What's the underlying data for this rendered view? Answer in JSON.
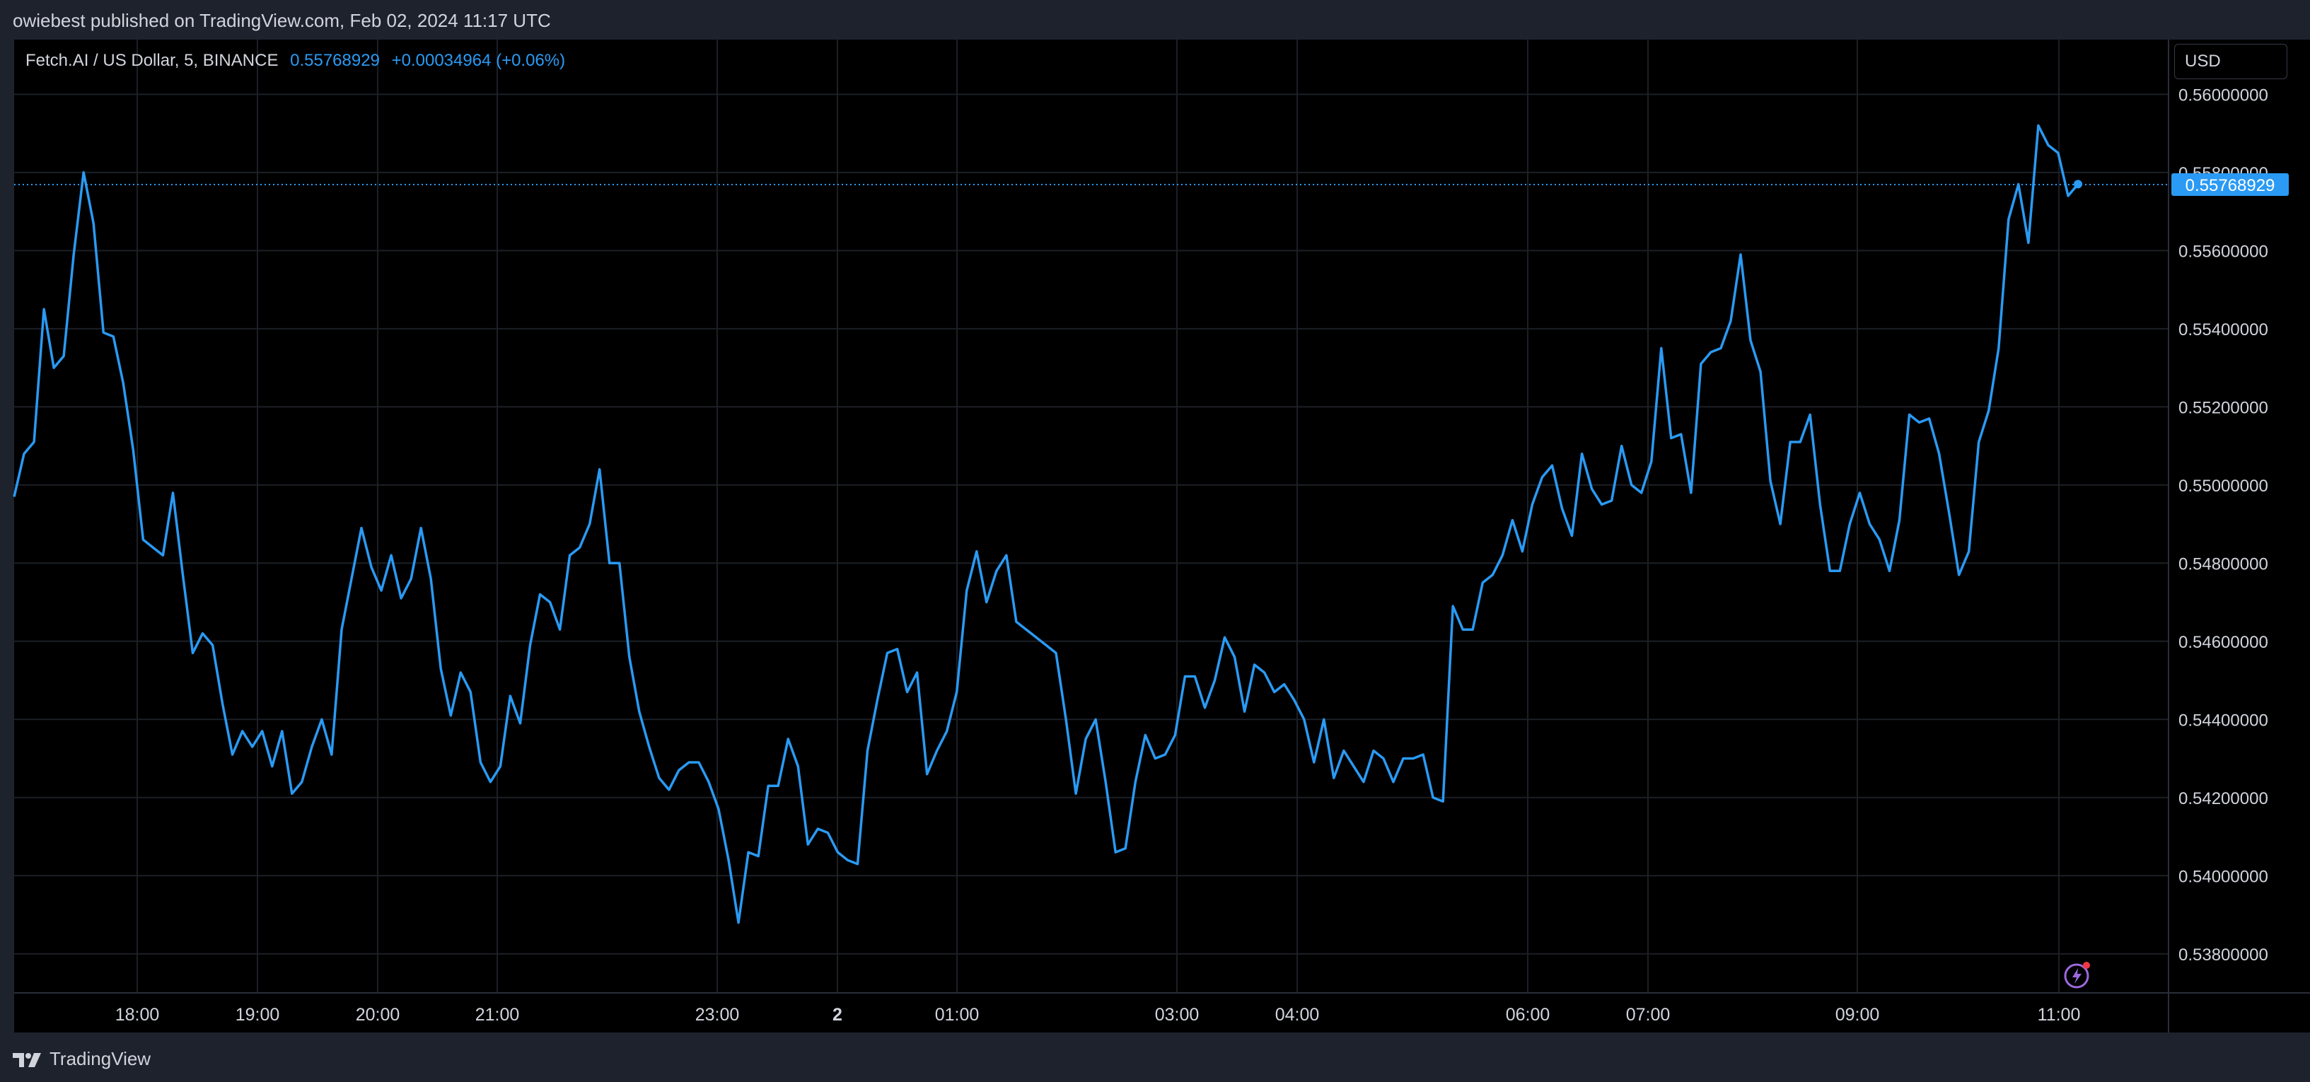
{
  "header": {
    "published_text": "owiebest published on TradingView.com, Feb 02, 2024 11:17 UTC"
  },
  "legend": {
    "symbol": "Fetch.AI / US Dollar, 5, BINANCE",
    "price": "0.55768929",
    "change": "+0.00034964 (+0.06%)"
  },
  "currency_button": "USD",
  "last_price_label": "0.55768929",
  "footer": {
    "brand": "TradingView"
  },
  "colors": {
    "line": "#2a9af4",
    "background": "#000000",
    "grid": "#1c1f26",
    "text": "#d1d4dc"
  },
  "icons": [
    "tradingview-logo-icon",
    "lightning-icon"
  ],
  "chart_data": {
    "type": "line",
    "series": [
      {
        "values": [
          0.5497,
          0.5508,
          0.5511,
          0.5545,
          0.553,
          0.5533,
          0.5559,
          0.558,
          0.5567,
          0.5539,
          0.5538,
          0.5526,
          0.5509,
          0.5486,
          0.5484,
          0.5482,
          0.5498,
          0.5477,
          0.5457,
          0.5462,
          0.5459,
          0.5444,
          0.5431,
          0.5437,
          0.5433,
          0.5437,
          0.5428,
          0.5437,
          0.5421,
          0.5424,
          0.5433,
          0.544,
          0.5431,
          0.5463,
          0.5476,
          0.5489,
          0.5479,
          0.5473,
          0.5482,
          0.5471,
          0.5476,
          0.5489,
          0.5476,
          0.5453,
          0.5441,
          0.5452,
          0.5447,
          0.5429,
          0.5424,
          0.5428,
          0.5446,
          0.5439,
          0.5459,
          0.5472,
          0.547,
          0.5463,
          0.5482,
          0.5484,
          0.549,
          0.5504,
          0.548,
          0.548,
          0.5456,
          0.5442,
          0.5433,
          0.5425,
          0.5422,
          0.5427,
          0.5429,
          0.5429,
          0.5424,
          0.5417,
          0.5404,
          0.5388,
          0.5406,
          0.5405,
          0.5423,
          0.5423,
          0.5435,
          0.5428,
          0.5408,
          0.5412,
          0.5411,
          0.5406,
          0.5404,
          0.5403,
          0.5432,
          0.5445,
          0.5457,
          0.5458,
          0.5447,
          0.5452,
          0.5426,
          0.5432,
          0.5437,
          0.5447,
          0.5473,
          0.5483,
          0.547,
          0.5478,
          0.5482,
          0.5465,
          0.5463,
          0.5461,
          0.5459,
          0.5457,
          0.544,
          0.5421,
          0.5435,
          0.544,
          0.5424,
          0.5406,
          0.5407,
          0.5424,
          0.5436,
          0.543,
          0.5431,
          0.5436,
          0.5451,
          0.5451,
          0.5443,
          0.545,
          0.5461,
          0.5456,
          0.5442,
          0.5454,
          0.5452,
          0.5447,
          0.5449,
          0.5445,
          0.544,
          0.5429,
          0.544,
          0.5425,
          0.5432,
          0.5428,
          0.5424,
          0.5432,
          0.543,
          0.5424,
          0.543,
          0.543,
          0.5431,
          0.542,
          0.5419,
          0.5469,
          0.5463,
          0.5463,
          0.5475,
          0.5477,
          0.5482,
          0.5491,
          0.5483,
          0.5495,
          0.5502,
          0.5505,
          0.5494,
          0.5487,
          0.5508,
          0.5499,
          0.5495,
          0.5496,
          0.551,
          0.55,
          0.5498,
          0.5506,
          0.5535,
          0.5512,
          0.5513,
          0.5498,
          0.5531,
          0.5534,
          0.5535,
          0.5542,
          0.5559,
          0.5537,
          0.5529,
          0.5501,
          0.549,
          0.5511,
          0.5511,
          0.5518,
          0.5495,
          0.5478,
          0.5478,
          0.549,
          0.5498,
          0.549,
          0.5486,
          0.5478,
          0.5491,
          0.5518,
          0.5516,
          0.5517,
          0.5508,
          0.5493,
          0.5477,
          0.5483,
          0.5511,
          0.5519,
          0.5535,
          0.5568,
          0.5577,
          0.5562,
          0.5592,
          0.5587,
          0.5585,
          0.5574,
          0.5577
        ]
      }
    ],
    "x_ticks": [
      "18:00",
      "19:00",
      "20:00",
      "21:00",
      "23:00",
      "2",
      "01:00",
      "03:00",
      "04:00",
      "06:00",
      "07:00",
      "09:00",
      "11:00"
    ],
    "y_ticks": [
      "0.53800000",
      "0.54000000",
      "0.54200000",
      "0.54400000",
      "0.54600000",
      "0.54800000",
      "0.55000000",
      "0.55200000",
      "0.55400000",
      "0.55600000",
      "0.55800000",
      "0.56000000"
    ],
    "ylim": [
      0.537,
      0.5614
    ],
    "last_value": 0.55768929,
    "grid": true
  }
}
